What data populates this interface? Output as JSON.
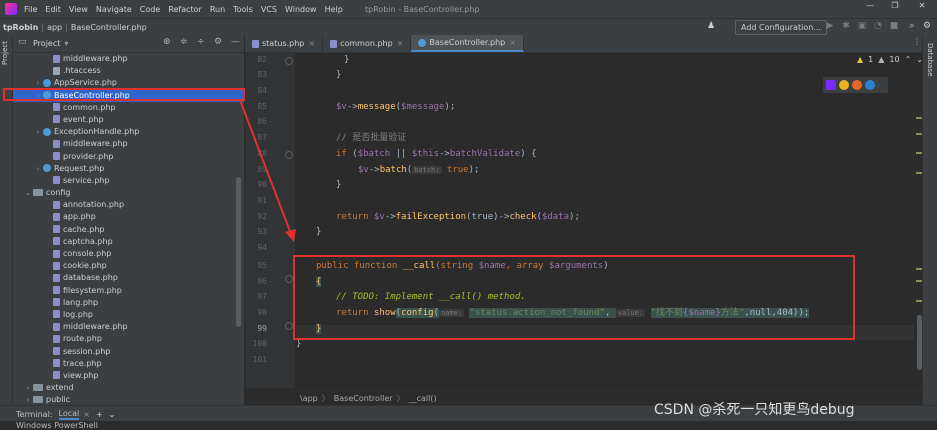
{
  "menubar": {
    "items": [
      "File",
      "Edit",
      "View",
      "Navigate",
      "Code",
      "Refactor",
      "Run",
      "Tools",
      "VCS",
      "Window",
      "Help"
    ],
    "window_title": "tpRobin - BaseController.php",
    "controls": [
      "—",
      "❐",
      "✕"
    ]
  },
  "navbar": {
    "crumbs": [
      "tpRobin",
      "app",
      "BaseController.php"
    ],
    "add_config": "Add Configuration..."
  },
  "left_stripe": {
    "project_tab": "Project"
  },
  "right_stripe": {
    "database_tab": "Database"
  },
  "project_panel": {
    "title": "Project",
    "tree": [
      {
        "label": "middleware.php",
        "indent": 3,
        "icon": "php",
        "arrow": ""
      },
      {
        "label": ".htaccess",
        "indent": 3,
        "icon": "file",
        "arrow": ""
      },
      {
        "label": "AppService.php",
        "indent": 2,
        "icon": "cls",
        "arrow": "›"
      },
      {
        "label": "BaseController.php",
        "indent": 2,
        "icon": "cls",
        "arrow": "›",
        "selected": true
      },
      {
        "label": "common.php",
        "indent": 3,
        "icon": "php",
        "arrow": ""
      },
      {
        "label": "event.php",
        "indent": 3,
        "icon": "php",
        "arrow": ""
      },
      {
        "label": "ExceptionHandle.php",
        "indent": 2,
        "icon": "cls",
        "arrow": "›"
      },
      {
        "label": "middleware.php",
        "indent": 3,
        "icon": "php",
        "arrow": ""
      },
      {
        "label": "provider.php",
        "indent": 3,
        "icon": "php",
        "arrow": ""
      },
      {
        "label": "Request.php",
        "indent": 2,
        "icon": "cls",
        "arrow": "›"
      },
      {
        "label": "service.php",
        "indent": 3,
        "icon": "php",
        "arrow": ""
      },
      {
        "label": "config",
        "indent": 1,
        "icon": "folder",
        "arrow": "⌄"
      },
      {
        "label": "annotation.php",
        "indent": 3,
        "icon": "php",
        "arrow": ""
      },
      {
        "label": "app.php",
        "indent": 3,
        "icon": "php",
        "arrow": ""
      },
      {
        "label": "cache.php",
        "indent": 3,
        "icon": "php",
        "arrow": ""
      },
      {
        "label": "captcha.php",
        "indent": 3,
        "icon": "php",
        "arrow": ""
      },
      {
        "label": "console.php",
        "indent": 3,
        "icon": "php",
        "arrow": ""
      },
      {
        "label": "cookie.php",
        "indent": 3,
        "icon": "php",
        "arrow": ""
      },
      {
        "label": "database.php",
        "indent": 3,
        "icon": "php",
        "arrow": ""
      },
      {
        "label": "filesystem.php",
        "indent": 3,
        "icon": "php",
        "arrow": ""
      },
      {
        "label": "lang.php",
        "indent": 3,
        "icon": "php",
        "arrow": ""
      },
      {
        "label": "log.php",
        "indent": 3,
        "icon": "php",
        "arrow": ""
      },
      {
        "label": "middleware.php",
        "indent": 3,
        "icon": "php",
        "arrow": ""
      },
      {
        "label": "route.php",
        "indent": 3,
        "icon": "php",
        "arrow": ""
      },
      {
        "label": "session.php",
        "indent": 3,
        "icon": "php",
        "arrow": ""
      },
      {
        "label": "trace.php",
        "indent": 3,
        "icon": "php",
        "arrow": ""
      },
      {
        "label": "view.php",
        "indent": 3,
        "icon": "php",
        "arrow": ""
      },
      {
        "label": "extend",
        "indent": 1,
        "icon": "folder",
        "arrow": "›"
      },
      {
        "label": "public",
        "indent": 1,
        "icon": "folder",
        "arrow": "›"
      }
    ]
  },
  "editor": {
    "tabs": [
      {
        "label": "status.php",
        "active": false
      },
      {
        "label": "common.php",
        "active": false
      },
      {
        "label": "BaseController.php",
        "active": true
      }
    ],
    "inspection": {
      "warnings": "1",
      "weak": "10"
    },
    "line_numbers": [
      "82",
      "83",
      "84",
      "85",
      "86",
      "87",
      "88",
      "89",
      "90",
      "91",
      "92",
      "93",
      "94",
      "95",
      "96",
      "97",
      "98",
      "99",
      "100",
      "101"
    ],
    "current_line": "99"
  },
  "code_text": {
    "l82": "}",
    "l83": "}",
    "l85_a": "$v",
    "l85_b": "->",
    "l85_c": "message",
    "l85_d": "(",
    "l85_e": "$message",
    "l85_f": ");",
    "l87": "// 是否批量验证",
    "l88_a": "if",
    "l88_b": " (",
    "l88_c": "$batch",
    "l88_d": " || ",
    "l88_e": "$this",
    "l88_f": "->",
    "l88_g": "batchValidate",
    "l88_h": ") {",
    "l89_a": "$v",
    "l89_b": "->",
    "l89_c": "batch",
    "l89_d": "(",
    "l89_hint": "batch:",
    "l89_e": "true",
    "l89_f": ");",
    "l90": "}",
    "l92_a": "return",
    "l92_b": " $v",
    "l92_c": "->",
    "l92_d": "failException",
    "l92_e": "(true)->",
    "l92_f": "check",
    "l92_g": "(",
    "l92_h": "$data",
    "l92_i": ");",
    "l93": "}",
    "l95_a": "public function",
    "l95_b": " __call",
    "l95_c": "(string ",
    "l95_d": "$name",
    "l95_e": ", array ",
    "l95_f": "$arguments",
    "l95_g": ")",
    "l96": "{",
    "l97_a": "// ",
    "l97_b": "TODO: Implement __call() method.",
    "l98_a": "return",
    "l98_b": " show",
    "l98_c": "(",
    "l98_d": "config",
    "l98_e": "(",
    "l98_hint1": "name:",
    "l98_s1": "\"status.action_not_found\"",
    "l98_f": ", ",
    "l98_hint2": "value:",
    "l98_s2a": "\"找不到",
    "l98_s2b": "{$name}",
    "l98_s2c": "方法\"",
    "l98_g": ",null,404));",
    "l99": "}",
    "l100": "}"
  },
  "bottom_breadcrumbs": [
    "\\app",
    "BaseController",
    "__call()"
  ],
  "terminal": {
    "label": "Terminal:",
    "tab": "Local",
    "text": "Windows PowerShell"
  },
  "watermark": "CSDN @杀死一只知更鸟debug"
}
